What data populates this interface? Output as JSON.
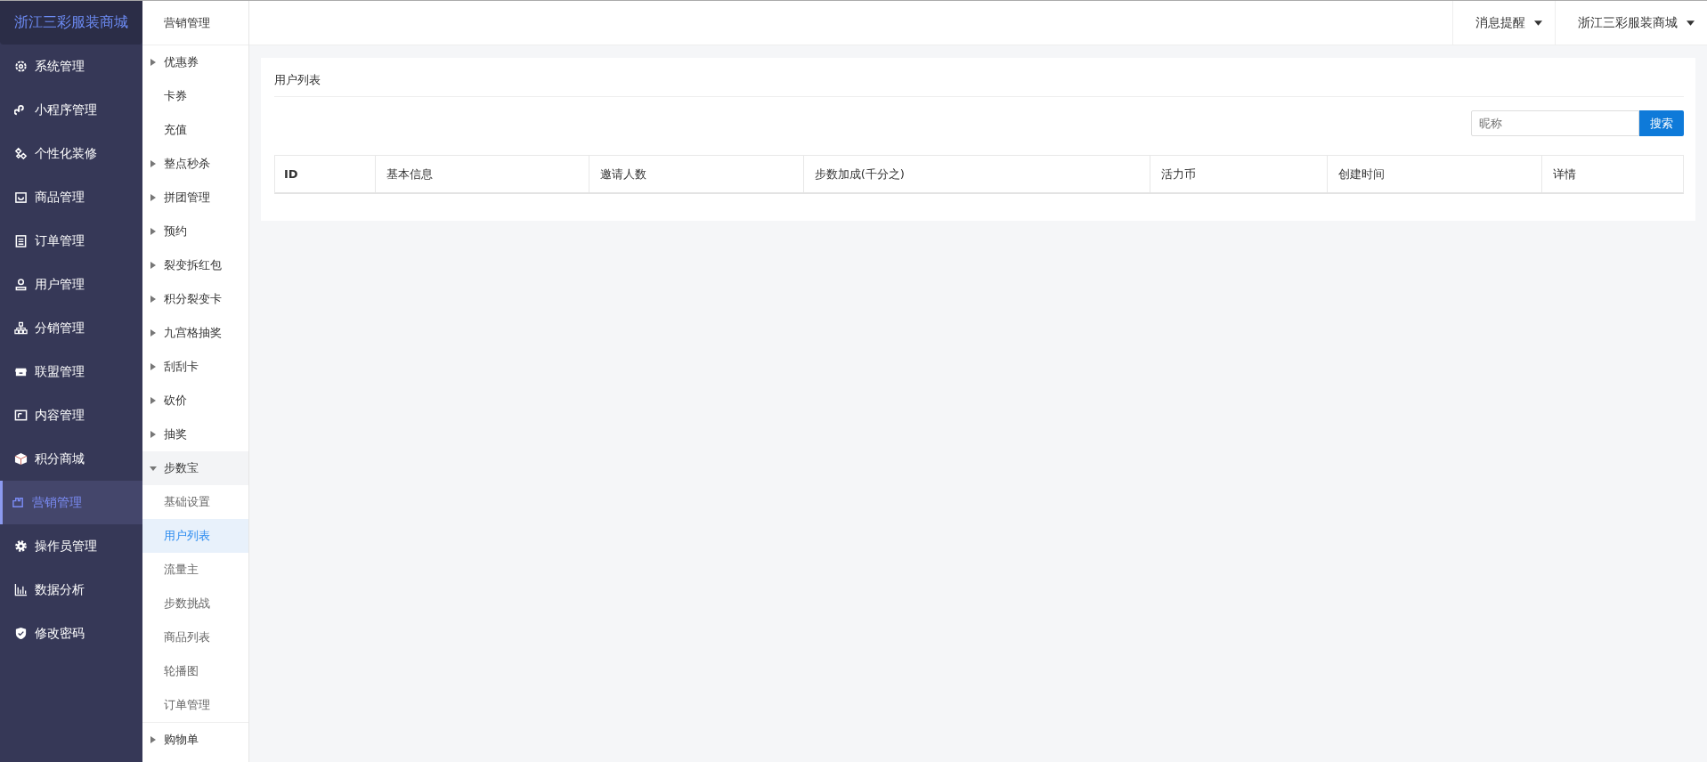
{
  "brand": "浙江三彩服装商城",
  "sidebar": {
    "items": [
      {
        "label": "系统管理",
        "selected": false
      },
      {
        "label": "小程序管理",
        "selected": false
      },
      {
        "label": "个性化装修",
        "selected": false
      },
      {
        "label": "商品管理",
        "selected": false
      },
      {
        "label": "订单管理",
        "selected": false
      },
      {
        "label": "用户管理",
        "selected": false
      },
      {
        "label": "分销管理",
        "selected": false
      },
      {
        "label": "联盟管理",
        "selected": false
      },
      {
        "label": "内容管理",
        "selected": false
      },
      {
        "label": "积分商城",
        "selected": false
      },
      {
        "label": "营销管理",
        "selected": true
      },
      {
        "label": "操作员管理",
        "selected": false
      },
      {
        "label": "数据分析",
        "selected": false
      },
      {
        "label": "修改密码",
        "selected": false
      }
    ]
  },
  "submenu": {
    "title": "营销管理",
    "items": [
      {
        "kind": "group",
        "label": "优惠券",
        "expanded": false
      },
      {
        "kind": "leaf",
        "label": "卡券",
        "selected": false
      },
      {
        "kind": "leaf",
        "label": "充值",
        "selected": false
      },
      {
        "kind": "group",
        "label": "整点秒杀",
        "expanded": false
      },
      {
        "kind": "group",
        "label": "拼团管理",
        "expanded": false
      },
      {
        "kind": "group",
        "label": "预约",
        "expanded": false
      },
      {
        "kind": "group",
        "label": "裂变拆红包",
        "expanded": false
      },
      {
        "kind": "group",
        "label": "积分裂变卡",
        "expanded": false
      },
      {
        "kind": "group",
        "label": "九宫格抽奖",
        "expanded": false
      },
      {
        "kind": "group",
        "label": "刮刮卡",
        "expanded": false
      },
      {
        "kind": "group",
        "label": "砍价",
        "expanded": false
      },
      {
        "kind": "group",
        "label": "抽奖",
        "expanded": false
      },
      {
        "kind": "group",
        "label": "步数宝",
        "expanded": true,
        "children": [
          {
            "label": "基础设置",
            "selected": false
          },
          {
            "label": "用户列表",
            "selected": true
          },
          {
            "label": "流量主",
            "selected": false
          },
          {
            "label": "步数挑战",
            "selected": false
          },
          {
            "label": "商品列表",
            "selected": false
          },
          {
            "label": "轮播图",
            "selected": false
          },
          {
            "label": "订单管理",
            "selected": false
          }
        ]
      },
      {
        "kind": "group",
        "label": "购物单",
        "expanded": false
      }
    ]
  },
  "header": {
    "menus": [
      "消息提醒",
      "浙江三彩服装商城"
    ]
  },
  "panel": {
    "title": "用户列表",
    "search": {
      "placeholder": "昵称",
      "button": "搜索"
    },
    "table": {
      "columns": [
        "ID",
        "基本信息",
        "邀请人数",
        "步数加成(千分之)",
        "活力币",
        "创建时间",
        "详情"
      ]
    }
  }
}
